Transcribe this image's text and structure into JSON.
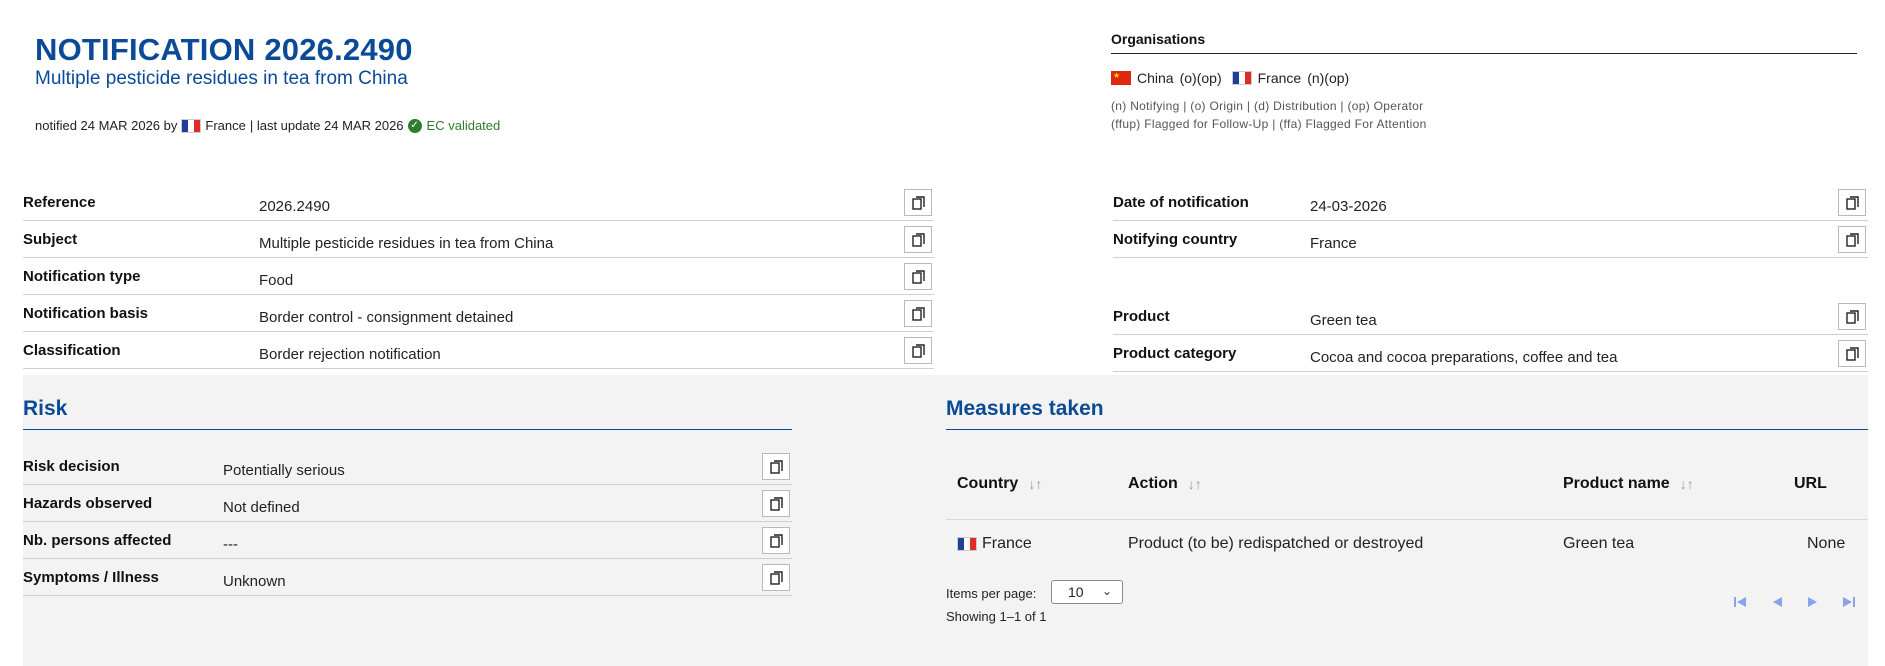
{
  "header": {
    "title": "NOTIFICATION 2026.2490",
    "subtitle": "Multiple pesticide residues in tea from China",
    "meta_prefix": "notified 24 MAR 2026 by",
    "meta_country": "France",
    "meta_suffix": "| last update 24 MAR 2026",
    "validated": "EC validated"
  },
  "organisations": {
    "title": "Organisations",
    "items": [
      {
        "country": "China",
        "roles": "(o)(op)",
        "flag": "flag-cn"
      },
      {
        "country": "France",
        "roles": "(n)(op)",
        "flag": "flag-fr"
      }
    ],
    "legend_line1": "(n) Notifying | (o) Origin | (d) Distribution | (op) Operator",
    "legend_line2": "(ffup) Flagged for Follow-Up | (ffa) Flagged For Attention"
  },
  "details_left": [
    {
      "label": "Reference",
      "value": "2026.2490"
    },
    {
      "label": "Subject",
      "value": "Multiple pesticide residues in tea from China"
    },
    {
      "label": "Notification type",
      "value": "Food"
    },
    {
      "label": "Notification basis",
      "value": "Border control - consignment detained"
    },
    {
      "label": "Classification",
      "value": "Border rejection notification"
    }
  ],
  "details_right": [
    {
      "label": "Date of notification",
      "value": "24-03-2026"
    },
    {
      "label": "Notifying country",
      "value": "France"
    },
    {
      "label": "Product",
      "value": "Green tea"
    },
    {
      "label": "Product category",
      "value": "Cocoa and cocoa preparations, coffee and tea"
    }
  ],
  "risk": {
    "title": "Risk",
    "rows": [
      {
        "label": "Risk decision",
        "value": "Potentially serious"
      },
      {
        "label": "Hazards observed",
        "value": "Not defined"
      },
      {
        "label": "Nb. persons affected",
        "value": "---"
      },
      {
        "label": "Symptoms / Illness",
        "value": "Unknown"
      }
    ]
  },
  "measures": {
    "title": "Measures taken",
    "columns": [
      "Country",
      "Action",
      "Product name",
      "URL"
    ],
    "rows": [
      {
        "country": "France",
        "action": "Product (to be) redispatched or destroyed",
        "product_name": "Green tea",
        "url": "None"
      }
    ],
    "items_per_page_label": "Items per page:",
    "items_per_page_value": "10",
    "showing": "Showing 1–1 of 1"
  },
  "icons": {
    "copy": "copy-icon",
    "sort": "sort-icon",
    "validated": "check-circle-icon",
    "first": "first-page-icon",
    "prev": "previous-page-icon",
    "next": "next-page-icon",
    "last": "last-page-icon"
  },
  "colors": {
    "brand_blue": "#0a4a96",
    "validated_green": "#2e7d32",
    "pager_blue": "#8aa3e8",
    "panel_grey": "#f3f3f3"
  }
}
